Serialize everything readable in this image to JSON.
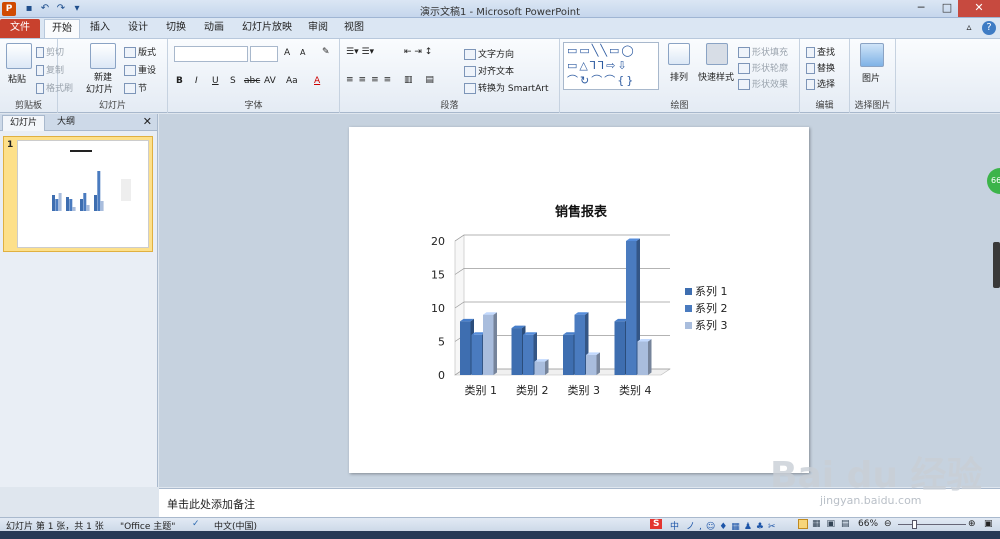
{
  "window": {
    "title": "演示文稿1 - Microsoft PowerPoint",
    "app_icon": "P"
  },
  "quick_access": [
    "save-icon",
    "undo-icon",
    "redo-icon",
    "customize-icon"
  ],
  "tabs": [
    "文件",
    "开始",
    "插入",
    "设计",
    "切换",
    "动画",
    "幻灯片放映",
    "审阅",
    "视图"
  ],
  "ribbon": {
    "clipboard": {
      "label": "剪贴板",
      "paste": "粘贴",
      "cut": "剪切",
      "copy": "复制",
      "format_painter": "格式刷"
    },
    "slides": {
      "label": "幻灯片",
      "new_slide_1": "新建",
      "new_slide_2": "幻灯片",
      "layout": "版式",
      "reset": "重设",
      "section": "节"
    },
    "font": {
      "label": "字体",
      "bold": "B",
      "italic": "I",
      "underline": "U",
      "strike": "S",
      "shadow": "abc",
      "spacing": "AV",
      "case": "Aa",
      "color": "A",
      "grow": "A",
      "shrink": "A"
    },
    "paragraph": {
      "label": "段落",
      "text_direction": "文字方向",
      "align_text": "对齐文本",
      "smartart": "转换为 SmartArt"
    },
    "drawing": {
      "label": "绘图",
      "arrange": "排列",
      "quick_styles": "快速样式",
      "shape_fill": "形状填充",
      "shape_outline": "形状轮廓",
      "shape_effects": "形状效果",
      "shapes_preview": "▭▭╲╲▭◯\n▭△⅂⅂⇨⇩\n⌒↻⌒⌒{}"
    },
    "editing": {
      "label": "编辑",
      "find": "查找",
      "replace": "替换",
      "select": "选择"
    },
    "select_picture": {
      "label": "选择图片",
      "picture": "图片"
    }
  },
  "panel": {
    "tab_slides": "幻灯片",
    "tab_outline": "大纲",
    "slide_number": "1",
    "close": "✕"
  },
  "notes_placeholder": "单击此处添加备注",
  "status": {
    "slide_info": "幻灯片 第 1 张，共 1 张",
    "theme": "\"Office 主题\"",
    "language": "中文(中国)",
    "zoom": "66%",
    "ime": "S",
    "ime_mode": "中"
  },
  "zoom_badge": "66",
  "watermark": {
    "brand": "Bai du 经验",
    "sub": "jingyan.baidu.com"
  },
  "chart_data": {
    "type": "bar",
    "title": "销售报表",
    "categories": [
      "类别 1",
      "类别 2",
      "类别 3",
      "类别 4"
    ],
    "series": [
      {
        "name": "系列 1",
        "values": [
          8,
          7,
          6,
          8
        ],
        "color": "#3e6eb0"
      },
      {
        "name": "系列 2",
        "values": [
          6,
          6,
          9,
          20
        ],
        "color": "#4a7bbf"
      },
      {
        "name": "系列 3",
        "values": [
          9,
          2,
          3,
          5
        ],
        "color": "#a9bddd"
      }
    ],
    "ylim": [
      0,
      20
    ],
    "yticks": [
      0,
      5,
      10,
      15,
      20
    ],
    "grid": true,
    "legend": "right",
    "style": "3d-clustered"
  }
}
